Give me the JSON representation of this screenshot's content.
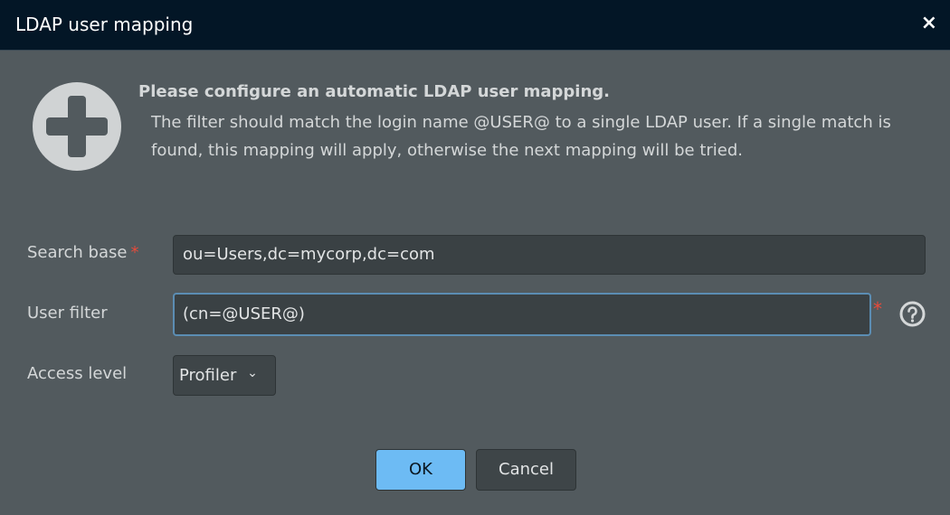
{
  "dialog": {
    "title": "LDAP user mapping",
    "close_label": "×",
    "intro_heading": "Please configure an automatic LDAP user mapping.",
    "intro_text": "The filter should match the login name @USER@ to a single LDAP user. If a single match is found, this mapping will apply, otherwise the next mapping will be tried."
  },
  "form": {
    "search_base": {
      "label": "Search base",
      "required": "*",
      "value": "ou=Users,dc=mycorp,dc=com"
    },
    "user_filter": {
      "label": "User filter",
      "required": "*",
      "value": "(cn=@USER@)"
    },
    "access_level": {
      "label": "Access level",
      "value": "Profiler",
      "chevron": "⌄"
    }
  },
  "buttons": {
    "ok": "OK",
    "cancel": "Cancel"
  },
  "colors": {
    "header": "#031626",
    "body": "#525a5e",
    "primary": "#6dbbf4",
    "required": "#e84a3a"
  }
}
